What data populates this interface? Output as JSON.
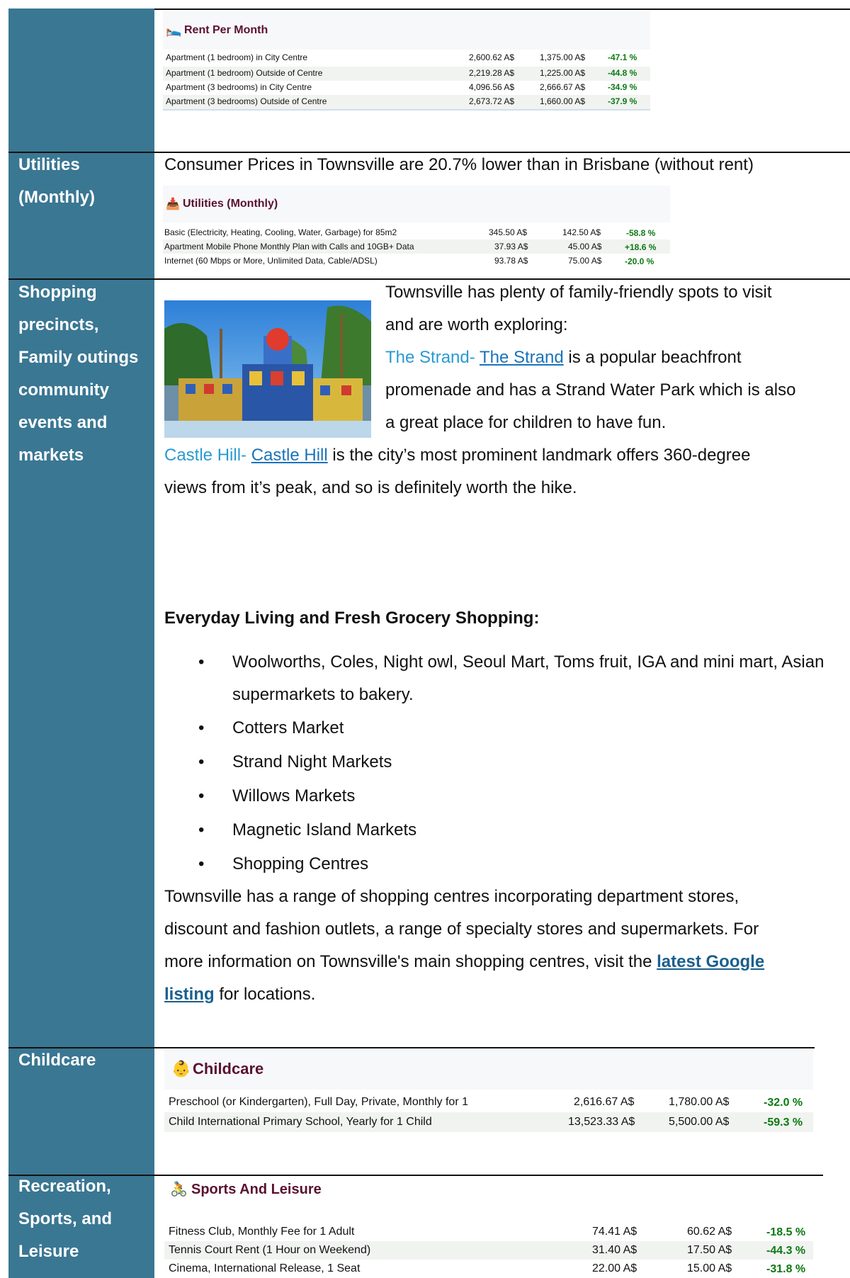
{
  "rent": {
    "title": "Rent Per Month",
    "rows": [
      {
        "label": "Apartment (1 bedroom) in City Centre",
        "a": "2,600.62 A$",
        "b": "1,375.00 A$",
        "pct": "-47.1 %"
      },
      {
        "label": "Apartment (1 bedroom) Outside of Centre",
        "a": "2,219.28 A$",
        "b": "1,225.00 A$",
        "pct": "-44.8 %"
      },
      {
        "label": "Apartment (3 bedrooms) in City Centre",
        "a": "4,096.56 A$",
        "b": "2,666.67 A$",
        "pct": "-34.9 %"
      },
      {
        "label": "Apartment (3 bedrooms) Outside of Centre",
        "a": "2,673.72 A$",
        "b": "1,660.00 A$",
        "pct": "-37.9 %"
      }
    ]
  },
  "utilities": {
    "side_label": "Utilities (Monthly)",
    "summary": "Consumer Prices in Townsville are 20.7% lower than in Brisbane (without rent)",
    "title": "Utilities (Monthly)",
    "rows": [
      {
        "label": "Basic (Electricity, Heating, Cooling, Water, Garbage) for 85m2",
        "a": "345.50 A$",
        "b": "142.50 A$",
        "pct": "-58.8 %"
      },
      {
        "label": "Apartment Mobile Phone Monthly Plan with Calls and 10GB+ Data",
        "a": "37.93 A$",
        "b": "45.00 A$",
        "pct": "+18.6 %"
      },
      {
        "label": "Internet (60 Mbps or More, Unlimited Data, Cable/ADSL)",
        "a": "93.78 A$",
        "b": "75.00 A$",
        "pct": "-20.0 %"
      }
    ]
  },
  "shopping": {
    "side_label": "Shopping precincts, Family outings community events and markets",
    "intro_1": "Townsville has plenty of family-friendly spots to visit",
    "intro_2": "and are worth exploring:",
    "strand_prefix": "The Strand- ",
    "strand_link": "The Strand",
    "strand_rest_1": " is a popular beachfront",
    "strand_rest_2": "promenade and has a Strand Water Park which is also",
    "strand_rest_3": "a great place for children to have fun.",
    "castle_prefix": "Castle Hill- ",
    "castle_link": "Castle Hill",
    "castle_rest_1": " is the city’s most prominent landmark offers 360-degree",
    "castle_rest_2": "views from it’s peak, and so is definitely worth the hike.",
    "grocery_heading": "Everyday Living and Fresh Grocery Shopping:",
    "bullets": [
      "Woolworths, Coles, Night owl, Seoul Mart, Toms fruit, IGA and mini mart, Asian supermarkets to bakery.",
      "Cotters Market",
      "Strand Night Markets",
      "Willows Markets",
      "Magnetic Island Markets",
      "Shopping Centres"
    ],
    "centres_1": "Townsville has a range of shopping centres incorporating department stores,",
    "centres_2": "discount and fashion outlets, a range of specialty stores and supermarkets. For",
    "centres_3": "more information on Townsville's main shopping centres, visit the ",
    "centres_link_1": "latest Google",
    "centres_link_2": "listing",
    "centres_end": " for locations."
  },
  "childcare": {
    "side_label": "Childcare",
    "title": "Childcare",
    "rows": [
      {
        "label": "Preschool (or Kindergarten), Full Day, Private, Monthly for 1",
        "a": "2,616.67 A$",
        "b": "1,780.00 A$",
        "pct": "-32.0 %"
      },
      {
        "label": "Child International Primary School, Yearly for 1 Child",
        "a": "13,523.33 A$",
        "b": "5,500.00 A$",
        "pct": "-59.3 %"
      }
    ]
  },
  "sports": {
    "side_label": "Recreation, Sports, and Leisure",
    "title": "Sports And Leisure",
    "rows": [
      {
        "label": "Fitness Club, Monthly Fee for 1 Adult",
        "a": "74.41 A$",
        "b": "60.62 A$",
        "pct": "-18.5 %"
      },
      {
        "label": "Tennis Court Rent (1 Hour on Weekend)",
        "a": "31.40 A$",
        "b": "17.50 A$",
        "pct": "-44.3 %"
      },
      {
        "label": "Cinema, International Release, 1 Seat",
        "a": "22.00 A$",
        "b": "15.00 A$",
        "pct": "-31.8 %"
      }
    ]
  }
}
